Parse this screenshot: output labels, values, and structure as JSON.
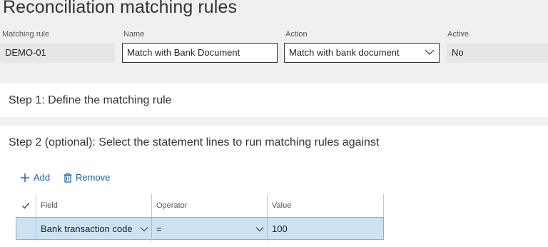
{
  "page": {
    "title": "Reconciliation matching rules"
  },
  "header_fields": {
    "matching_rule": {
      "label": "Matching rule",
      "value": "DEMO-01"
    },
    "name": {
      "label": "Name",
      "value": "Match with Bank Document"
    },
    "action": {
      "label": "Action",
      "value": "Match with bank document",
      "icon": "chevron-down-icon"
    },
    "active": {
      "label": "Active",
      "value": "No"
    }
  },
  "step1": {
    "title": "Step 1: Define the matching rule"
  },
  "step2": {
    "title": "Step 2 (optional): Select the statement lines to run matching rules against",
    "toolbar": {
      "add_label": "Add",
      "add_icon": "plus-icon",
      "remove_label": "Remove",
      "remove_icon": "trash-icon"
    },
    "grid": {
      "columns": [
        "Field",
        "Operator",
        "Value"
      ],
      "rows": [
        {
          "field": "Bank transaction code",
          "operator": "=",
          "value": "100",
          "selected": true
        }
      ]
    }
  },
  "colors": {
    "background": "#f0f0f0",
    "link": "#1a5fa8",
    "selected_row": "#cde3f4"
  }
}
